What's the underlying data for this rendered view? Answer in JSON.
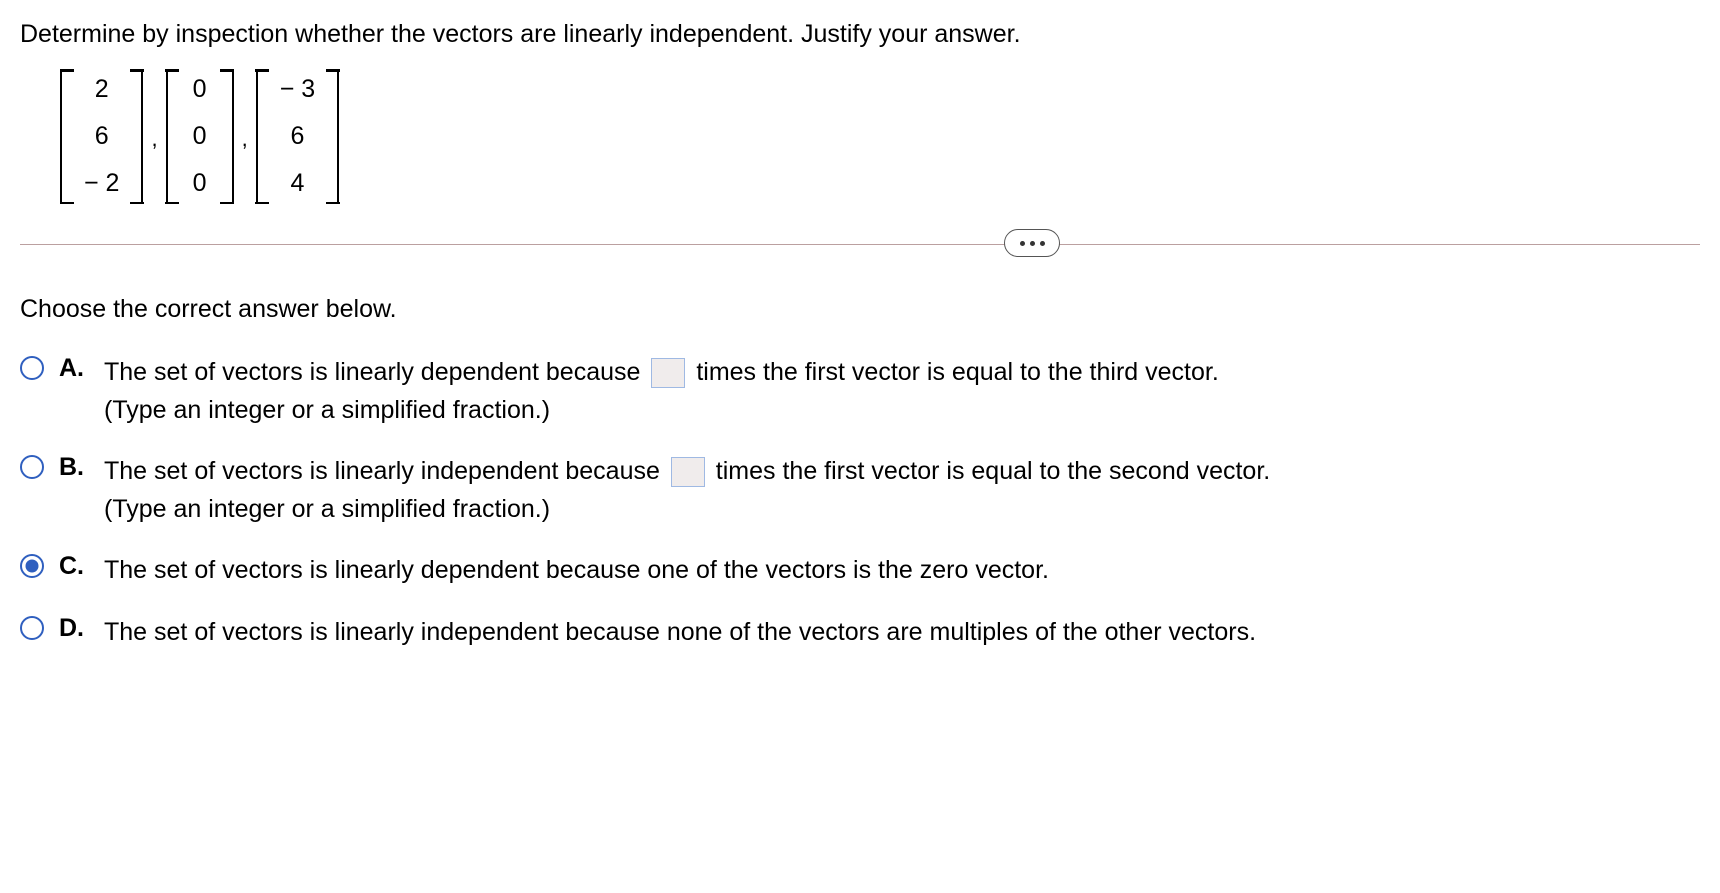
{
  "question": "Determine by inspection whether the vectors are linearly independent. Justify your answer.",
  "vectors": {
    "v1": {
      "r1": "2",
      "r2": "6",
      "r3": "− 2"
    },
    "v2": {
      "r1": "0",
      "r2": "0",
      "r3": "0"
    },
    "v3": {
      "r1": "− 3",
      "r2": "6",
      "r3": "4"
    }
  },
  "sep": ",",
  "prompt": "Choose the correct answer below.",
  "options": {
    "a": {
      "letter": "A.",
      "text_before": "The set of vectors is linearly dependent because ",
      "text_after": " times the first vector is equal to the third vector.",
      "hint": "(Type an integer or a simplified fraction.)",
      "input_value": ""
    },
    "b": {
      "letter": "B.",
      "text_before": "The set of vectors is linearly independent because ",
      "text_after": " times the first vector is equal to the second vector.",
      "hint": "(Type an integer or a simplified fraction.)",
      "input_value": ""
    },
    "c": {
      "letter": "C.",
      "text": "The set of vectors is linearly dependent because one of the vectors is the zero vector."
    },
    "d": {
      "letter": "D.",
      "text": "The set of vectors is linearly independent because none of the vectors are multiples of the other vectors."
    }
  },
  "selected": "c"
}
